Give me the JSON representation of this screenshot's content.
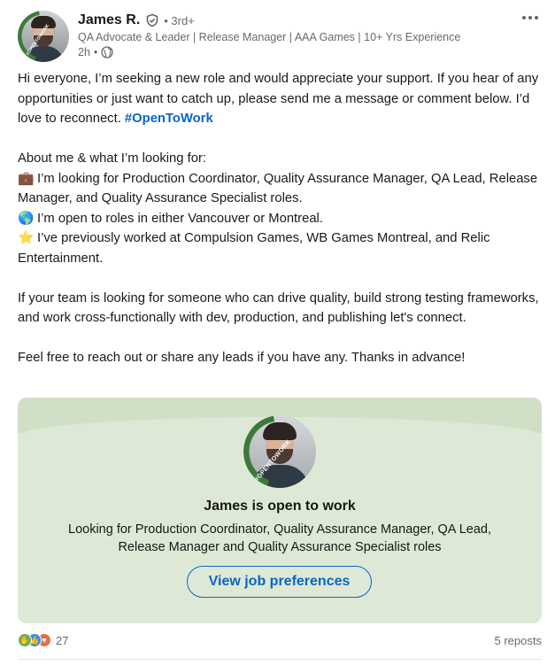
{
  "post": {
    "author": {
      "name": "James R.",
      "degree": "• 3rd+",
      "headline": "QA Advocate & Leader | Release Manager | AAA Games | 10+ Yrs Experience",
      "time": "2h",
      "avatar_badge": "#OPENTOWORK"
    },
    "body": {
      "intro": "Hi everyone, I’m seeking a new role and would appreciate your support. If you hear of any opportunities or just want to catch up, please send me a message or comment below. I’d love to reconnect. ",
      "hashtag": "#OpenToWork",
      "about_heading": "About me & what I’m looking for:",
      "bullets": [
        {
          "emoji": "💼",
          "text": "I’m looking for Production Coordinator, Quality Assurance Manager, QA Lead, Release Manager, and Quality Assurance Specialist roles."
        },
        {
          "emoji": "🌎",
          "text": "I’m open to roles in either Vancouver or Montreal."
        },
        {
          "emoji": "⭐",
          "text": "I’ve previously worked at Compulsion Games, WB Games Montreal, and Relic Entertainment."
        }
      ],
      "team_paragraph": "If your team is looking for someone who can drive quality, build strong testing frameworks, and work cross-functionally with dev, production, and publishing let's connect.",
      "closing": "Feel free to reach out or share any leads if you have any. Thanks in advance!"
    },
    "open_to_work_card": {
      "badge": "#OPENTOWORK",
      "title": "James is open to work",
      "description": "Looking for Production Coordinator, Quality Assurance Manager, QA Lead, Release Manager and Quality Assurance Specialist roles",
      "button": "View job preferences",
      "bg_color": "#dde9d6"
    },
    "social": {
      "reaction_count": "27",
      "reactions": [
        "celebrate-icon",
        "like-icon",
        "love-icon"
      ],
      "reposts": "5 reposts"
    }
  },
  "colors": {
    "accent": "#0a66c2",
    "otw_green": "#3d7a3a"
  }
}
